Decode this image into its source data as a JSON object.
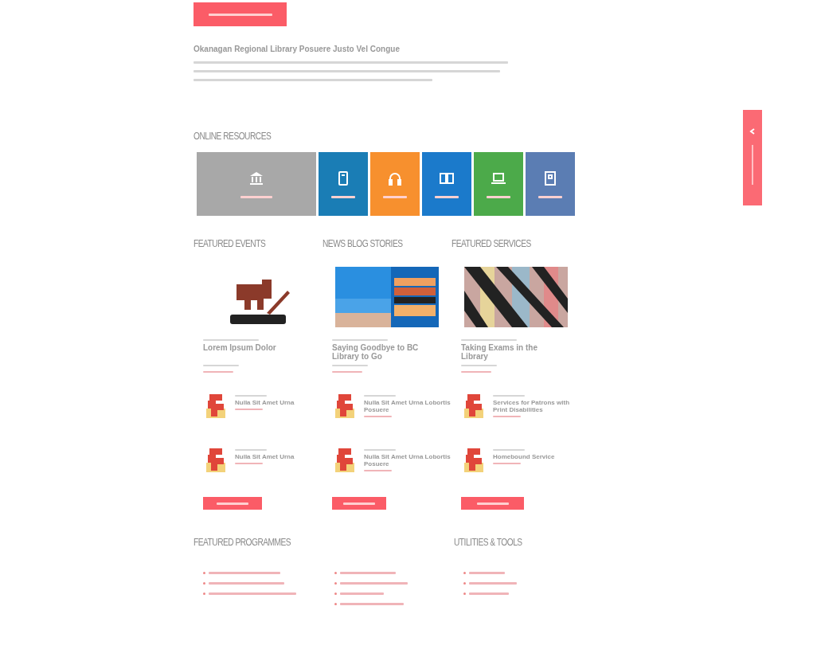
{
  "intro": {
    "title": "Okanagan Regional Library Posuere Justo Vel Congue"
  },
  "online_resources": {
    "heading": "ONLINE RESOURCES",
    "tiles": [
      {
        "kind": "library",
        "color": "#a8a8a8"
      },
      {
        "kind": "tablet",
        "color": "#1a7db5"
      },
      {
        "kind": "headphones",
        "color": "#f7902e"
      },
      {
        "kind": "book",
        "color": "#1b7acb"
      },
      {
        "kind": "laptop",
        "color": "#4caa4a"
      },
      {
        "kind": "document",
        "color": "#5b7db3"
      }
    ]
  },
  "columns": [
    {
      "heading": "FEATURED EVENTS",
      "feature": {
        "kind": "logo",
        "title": "Lorem Ipsum Dolor"
      },
      "items": [
        {
          "title": "Nulla Sit Amet Urna"
        },
        {
          "title": "Nulla Sit Amet Urna"
        }
      ]
    },
    {
      "heading": "NEWS BLOG STORIES",
      "feature": {
        "kind": "beach",
        "title": "Saying Goodbye to BC Library to Go"
      },
      "items": [
        {
          "title": "Nulla Sit Amet Urna Lobortis Posuere"
        },
        {
          "title": "Nulla Sit Amet Urna Lobortis Posuere"
        }
      ]
    },
    {
      "heading": "FEATURED SERVICES",
      "feature": {
        "kind": "shelves",
        "title": "Taking Exams in the Library"
      },
      "items": [
        {
          "title": "Services for Patrons with Print Disabilities"
        },
        {
          "title": "Homebound Service"
        }
      ]
    }
  ],
  "programmes": {
    "heading": "FEATURED PROGRAMMES"
  },
  "utilities": {
    "heading": "UTILITIES & TOOLS"
  }
}
